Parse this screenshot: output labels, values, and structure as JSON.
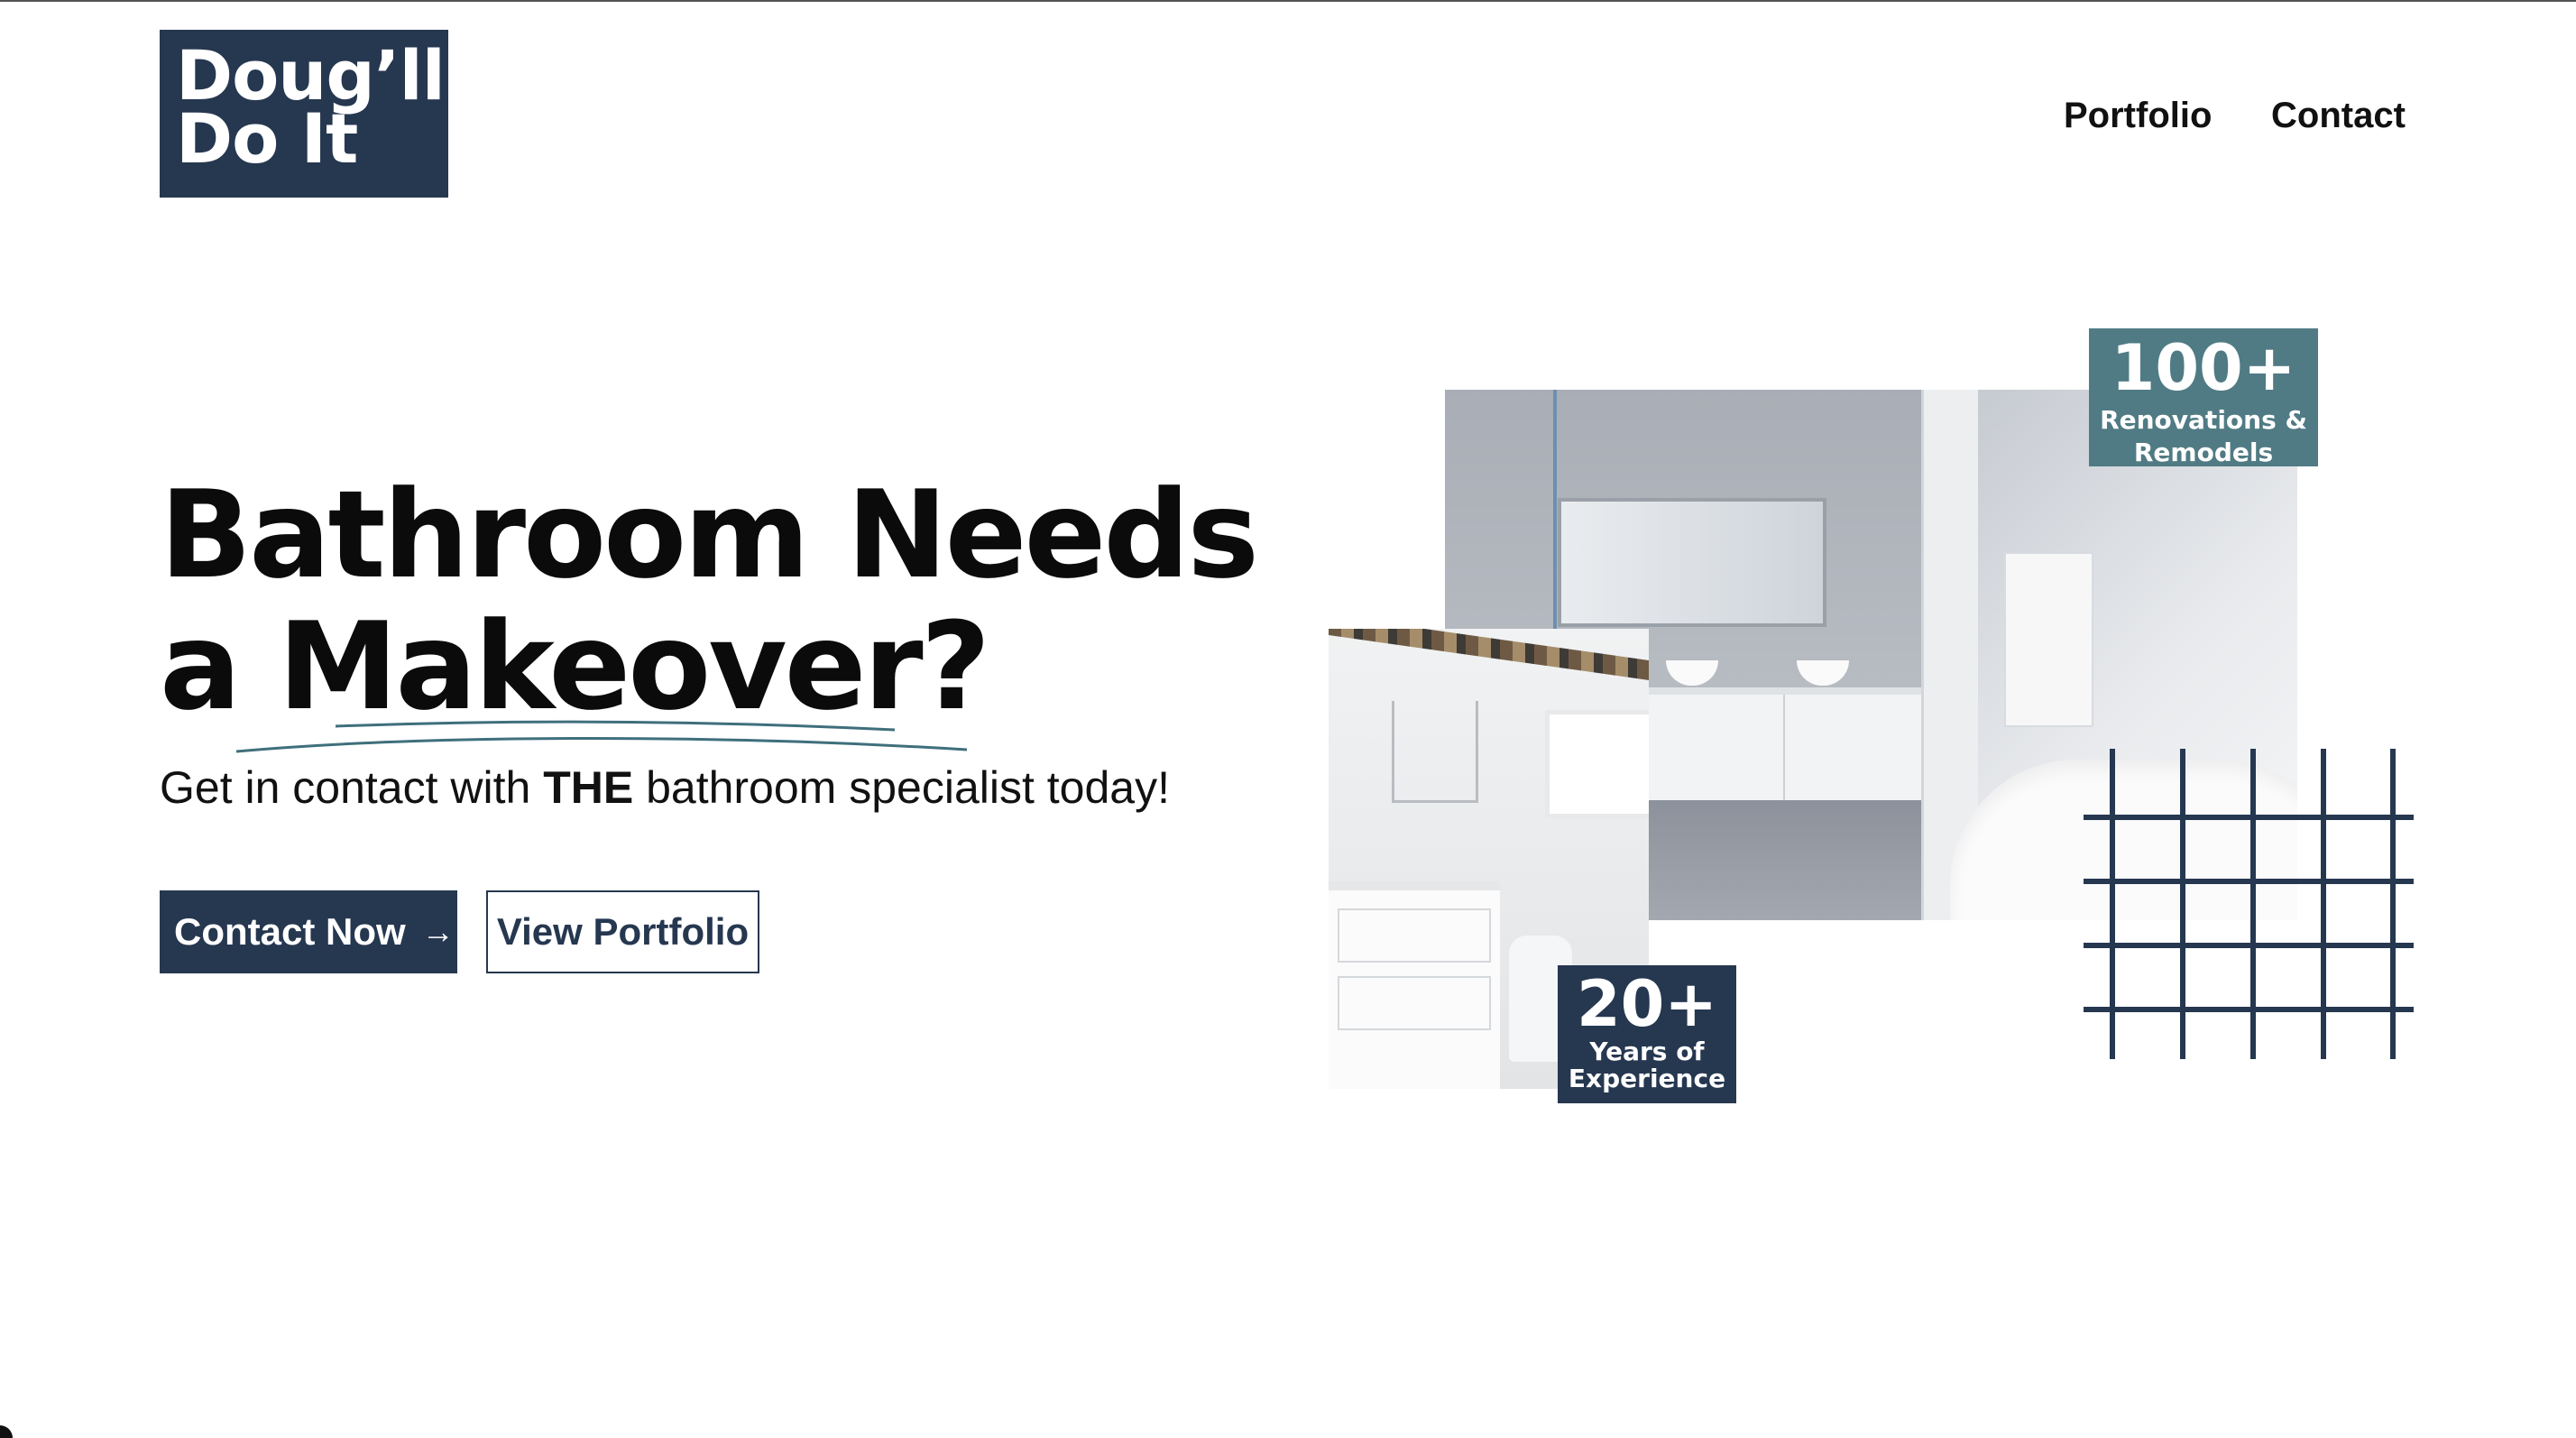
{
  "brand": {
    "logo_line1": "Doug’ll",
    "logo_line2": "Do It",
    "navy": "#263750",
    "teal": "#507b84"
  },
  "nav": {
    "portfolio": "Portfolio",
    "contact": "Contact"
  },
  "hero": {
    "title_line1": "Bathroom Needs",
    "title_line2": "a Makeover?",
    "subtitle_pre": "Get in contact with ",
    "subtitle_bold": "THE",
    "subtitle_post": " bathroom specialist today!"
  },
  "buttons": {
    "contact_now": "Contact Now",
    "arrow_icon": "→",
    "view_portfolio": "View Portfolio"
  },
  "badges": {
    "renovations": {
      "number": "100+",
      "label_line1": "Renovations &",
      "label_line2": "Remodels"
    },
    "experience": {
      "number": "20+",
      "label_line1": "Years of",
      "label_line2": "Experience"
    }
  },
  "images": {
    "main_photo": "modern-bathroom-vanity-and-tub",
    "secondary_photo": "white-bathroom-vanity-and-toilet",
    "decoration": "grid-pattern"
  }
}
